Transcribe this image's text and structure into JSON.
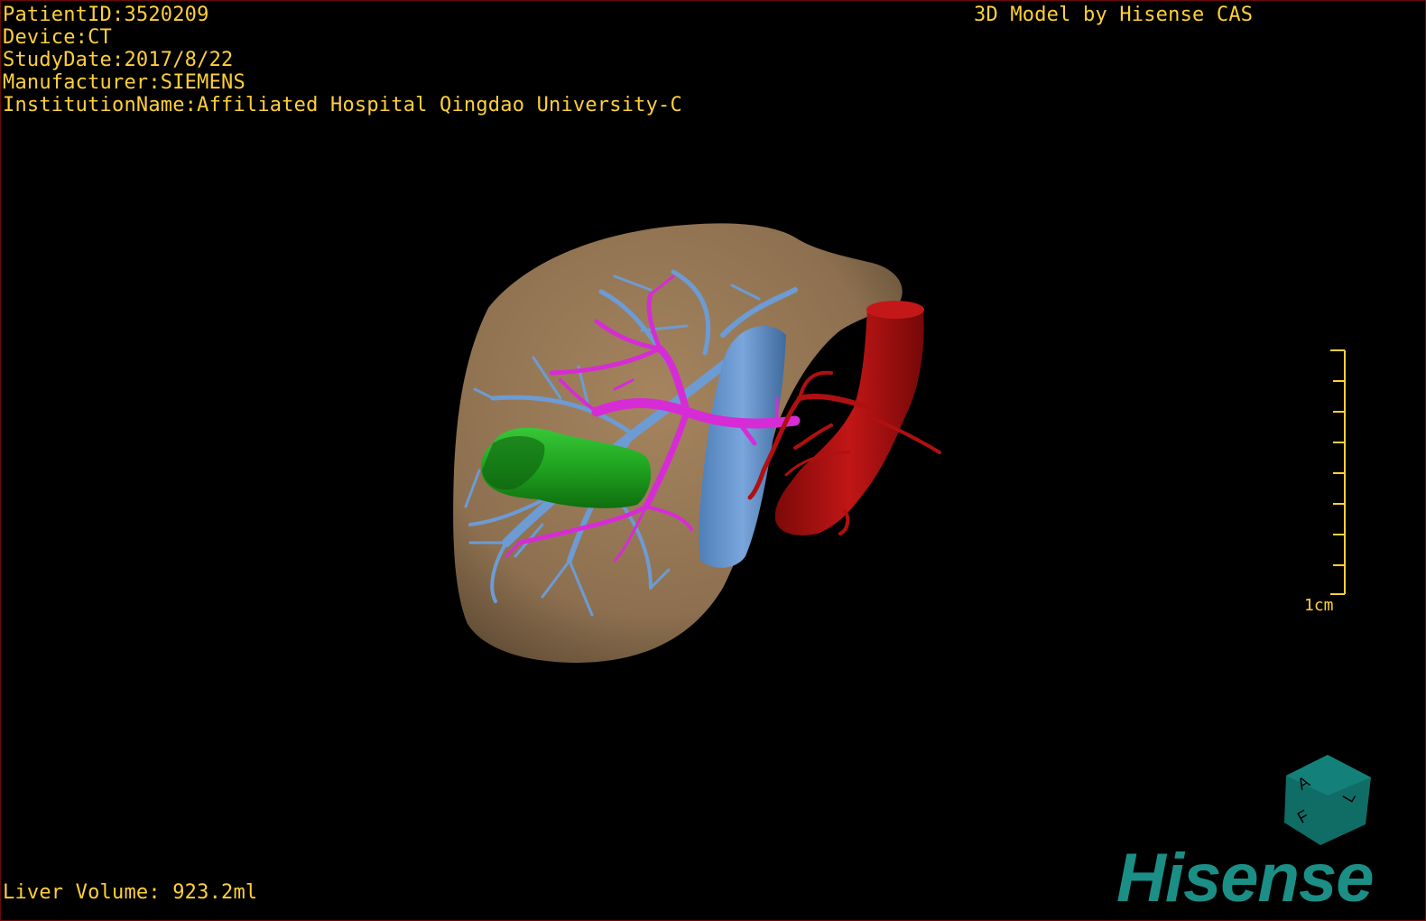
{
  "patient_info": {
    "patient_id": "PatientID:3520209",
    "device": "Device:CT",
    "study_date": "StudyDate:2017/8/22",
    "manufacturer": "Manufacturer:SIEMENS",
    "institution": "InstitutionName:Affiliated Hospital Qingdao University-C"
  },
  "model_credit": "3D Model by Hisense CAS",
  "liver_volume": "Liver Volume: 923.2ml",
  "scale_bar": {
    "label": "1cm"
  },
  "orientation_cube": {
    "face_labels": [
      "A",
      "F",
      "L"
    ],
    "color": "#0f6d66"
  },
  "brand": {
    "name": "Hisense",
    "color": "#1b8f86"
  },
  "colors": {
    "overlay_text": "#ffd03a",
    "liver": "#9a7a55",
    "hepatic_vein": "#6d9bd4",
    "portal_vein": "#d62cd6",
    "tumor": "#1a9d1a",
    "artery": "#b01010",
    "border": "#6a0a0a"
  },
  "structures": [
    "liver",
    "hepatic-vein",
    "portal-vein",
    "tumor",
    "artery"
  ]
}
